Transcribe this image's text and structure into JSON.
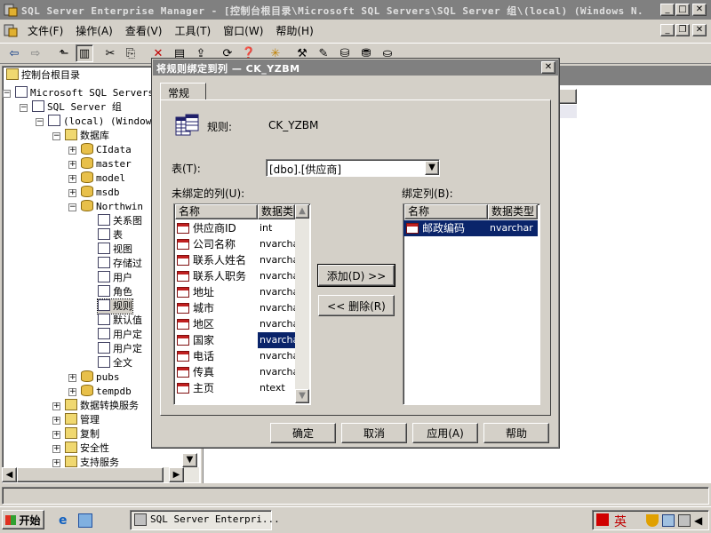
{
  "main_window": {
    "title": "SQL Server Enterprise Manager - [控制台根目录\\Microsoft SQL Servers\\SQL Server 组\\(local) (Windows N...",
    "menu": [
      "文件(F)",
      "操作(A)",
      "查看(V)",
      "工具(T)",
      "窗口(W)",
      "帮助(H)"
    ]
  },
  "tree": {
    "root": "控制台根目录",
    "items": [
      {
        "label": "Microsoft SQL Servers",
        "icon": "server-group-icon"
      },
      {
        "label": "SQL Server 组",
        "icon": "server-group-icon"
      },
      {
        "label": "(local) (Windows",
        "icon": "server-running-icon"
      },
      {
        "label": "数据库",
        "icon": "folder-icon"
      },
      {
        "label": "CIdata",
        "icon": "database-icon"
      },
      {
        "label": "master",
        "icon": "database-icon"
      },
      {
        "label": "model",
        "icon": "database-icon"
      },
      {
        "label": "msdb",
        "icon": "database-icon"
      },
      {
        "label": "Northwin",
        "icon": "database-icon"
      },
      {
        "label": "关系图",
        "icon": "diagram-icon"
      },
      {
        "label": "表",
        "icon": "table-icon"
      },
      {
        "label": "视图",
        "icon": "view-icon"
      },
      {
        "label": "存储过",
        "icon": "stored-procedure-icon"
      },
      {
        "label": "用户",
        "icon": "user-icon"
      },
      {
        "label": "角色",
        "icon": "role-icon"
      },
      {
        "label": "规则",
        "icon": "rule-icon"
      },
      {
        "label": "默认值",
        "icon": "default-icon"
      },
      {
        "label": "用户定",
        "icon": "user-type-icon"
      },
      {
        "label": "用户定",
        "icon": "user-function-icon"
      },
      {
        "label": "全文",
        "icon": "fulltext-icon"
      },
      {
        "label": "pubs",
        "icon": "database-icon"
      },
      {
        "label": "tempdb",
        "icon": "database-icon"
      },
      {
        "label": "数据转换服务",
        "icon": "folder-icon"
      },
      {
        "label": "管理",
        "icon": "folder-icon"
      },
      {
        "label": "复制",
        "icon": "folder-icon"
      },
      {
        "label": "安全性",
        "icon": "folder-icon"
      },
      {
        "label": "支持服务",
        "icon": "folder-icon"
      }
    ]
  },
  "dialog": {
    "title": "将规则绑定到列 — CK_YZBM",
    "tab": "常规",
    "rule_label": "规则:",
    "rule_value": "CK_YZBM",
    "table_label": "表(T):",
    "table_value": "[dbo].[供应商]",
    "unbound_label": "未绑定的列(U):",
    "bound_label": "绑定列(B):",
    "columns_header": {
      "name": "名称",
      "type": "数据类型"
    },
    "unbound_columns": [
      {
        "name": "供应商ID",
        "type": "int"
      },
      {
        "name": "公司名称",
        "type": "nvarchar"
      },
      {
        "name": "联系人姓名",
        "type": "nvarchar"
      },
      {
        "name": "联系人职务",
        "type": "nvarchar"
      },
      {
        "name": "地址",
        "type": "nvarchar"
      },
      {
        "name": "城市",
        "type": "nvarchar"
      },
      {
        "name": "地区",
        "type": "nvarchar"
      },
      {
        "name": "国家",
        "type": "nvarchar"
      },
      {
        "name": "电话",
        "type": "nvarchar"
      },
      {
        "name": "传真",
        "type": "nvarchar"
      },
      {
        "name": "主页",
        "type": "ntext"
      }
    ],
    "unbound_type_header": "数据类",
    "bound_columns": [
      {
        "name": "邮政编码",
        "type": "nvarchar"
      }
    ],
    "add_button": "添加(D) >>",
    "remove_button": "<< 删除(R)",
    "ok_button": "确定",
    "cancel_button": "取消",
    "apply_button": "应用(A)",
    "help_button": "帮助"
  },
  "taskbar": {
    "start": "开始",
    "task": "SQL Server Enterpri...",
    "ime": "英"
  }
}
